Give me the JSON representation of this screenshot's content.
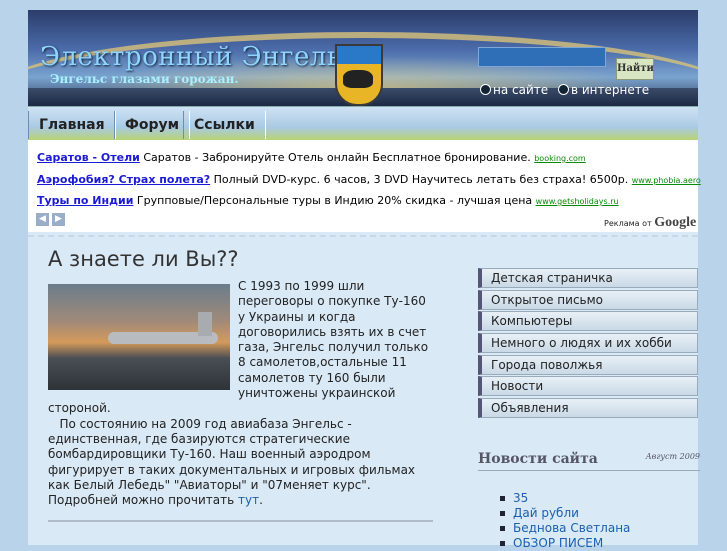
{
  "header": {
    "title": "Электронный Энгельс",
    "subtitle": "Энгельс глазами горожан.",
    "search": {
      "button_label": "Найти",
      "value": ""
    },
    "radio_options": [
      "на сайте",
      "в интернете"
    ]
  },
  "nav": {
    "items": [
      "Главная",
      "Форум",
      "Ссылки"
    ]
  },
  "ads": [
    {
      "title": "Саратов - Отели",
      "text": "Саратов - Забронируйте Отель онлайн Бесплатное бронирование.",
      "url": "booking.com"
    },
    {
      "title": "Аэрофобия? Страх полета?",
      "text": "Полный DVD-курс. 6 часов, 3 DVD Научитесь летать без страха! 6500р.",
      "url": "www.phobia.aero"
    },
    {
      "title": "Туры по Индии",
      "text": "Групповые/Персональные туры в Индию 20% скидка - лучшая цена",
      "url": "www.getsholidays.ru"
    }
  ],
  "ads_footer": {
    "prefix": "Реклама от",
    "brand": "Google"
  },
  "article": {
    "heading": "А знаете ли Вы??",
    "p1": "С 1993 по 1999 шли переговоры о покупке Ту-160 у Украины и когда договорились взять их в счет газа, Энгельс получил только 8 самолетов,остальные 11 самолетов ту 160 были уничтожены украинской стороной.",
    "p2": "По состоянию на 2009 год авиабаза Энгельс - единственная, где базируются стратегические бомбардировщики Ту-160. Наш военный аэродром фигурирует в таких документальных и игровых фильмах как Белый Лебедь\" \"Авиаторы\" и \"07меняет курс\". Подробней можно прочитать",
    "link": "тут",
    "end": "."
  },
  "sidebar": {
    "menu": [
      "Детская страничка",
      "Открытое письмо",
      "Компьютеры",
      "Немного о людях и их хобби",
      "Города поволжья",
      "Новости",
      "Объявления"
    ],
    "news_title": "Новости сайта",
    "news_date": "Август 2009",
    "news": [
      "35",
      "Дай рубли",
      "Беднова Светлана",
      "ОБЗОР ПИСЕМ"
    ]
  }
}
